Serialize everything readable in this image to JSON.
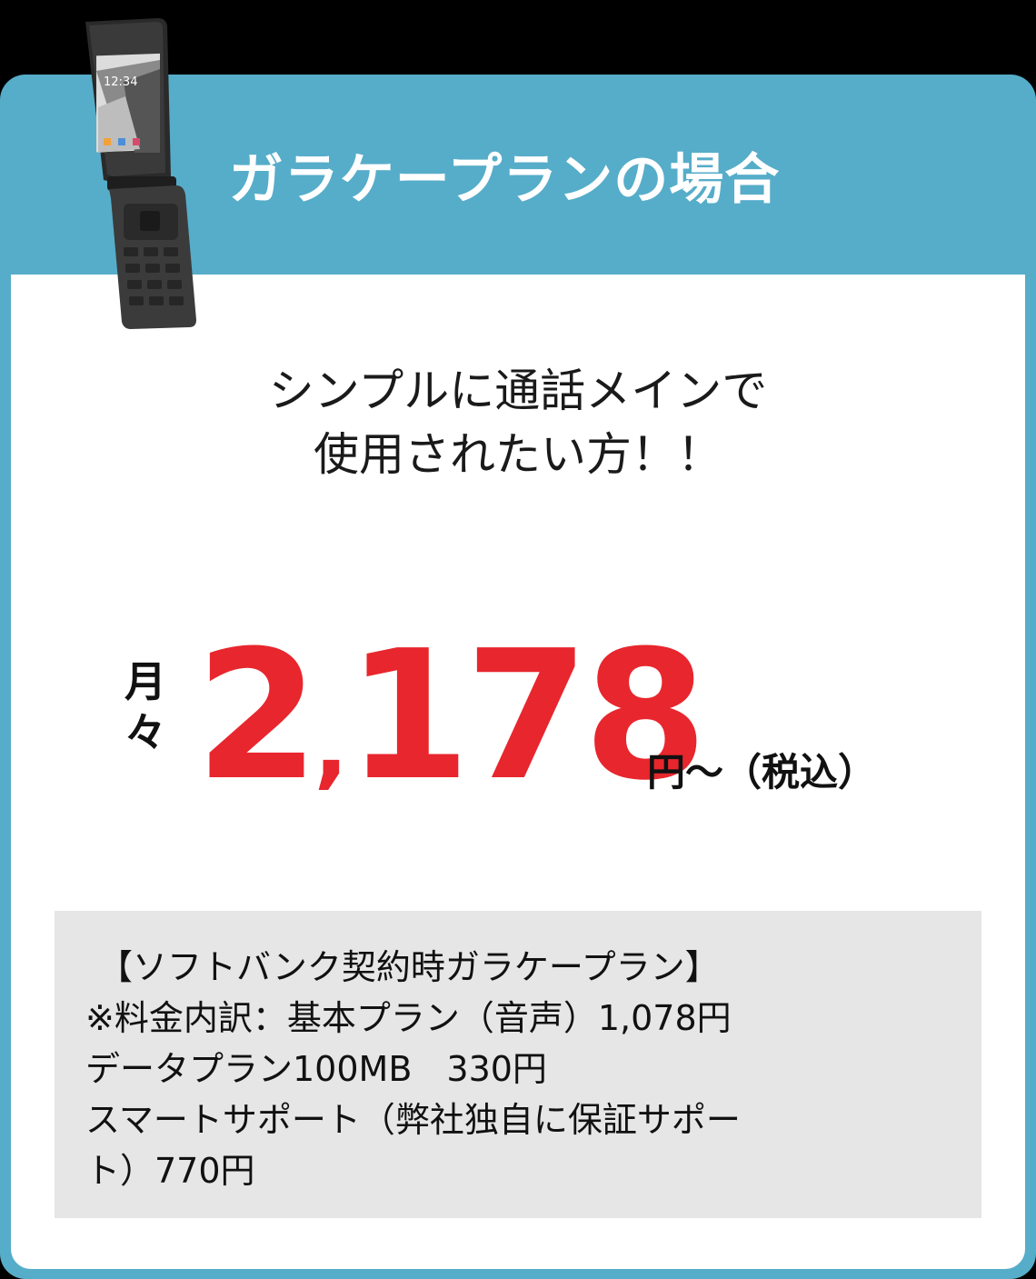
{
  "header": {
    "title": "ガラケープランの場合"
  },
  "tagline": {
    "line1": "シンプルに通話メインで",
    "line2": "使用されたい方！！"
  },
  "price": {
    "prefix_line1": "月",
    "prefix_line2": "々",
    "amount_head": "2",
    "amount_comma": ",",
    "amount_tail": "178",
    "unit": "円〜（税込）"
  },
  "details": {
    "lines": [
      "【ソフトバンク契約時ガラケープラン】",
      "※料金内訳：基本プラン（音声）1,078円",
      "データプラン100MB　330円",
      "スマートサポート（弊社独自に保証サポー",
      "ト）770円"
    ]
  },
  "phone": {
    "clock": "12:34"
  },
  "colors": {
    "accent": "#56adc9",
    "price": "#e8262d",
    "detail_bg": "#e6e6e6"
  }
}
